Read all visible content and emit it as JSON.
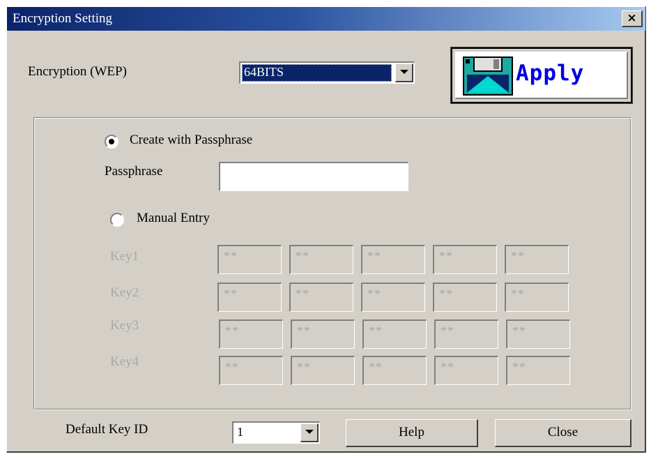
{
  "window": {
    "title": "Encryption Setting",
    "close_glyph": "×"
  },
  "encryption": {
    "label": "Encryption (WEP)",
    "selected": "64BITS"
  },
  "apply_button": {
    "label": "Apply",
    "icon": "floppy-disk-icon"
  },
  "passphrase_mode": {
    "create_label": "Create with Passphrase",
    "create_checked": true,
    "passphrase_label": "Passphrase",
    "passphrase_value": ""
  },
  "manual_entry": {
    "label": "Manual Entry",
    "checked": false,
    "keys": [
      {
        "label": "Key1",
        "bytes": [
          "**",
          "**",
          "**",
          "**",
          "**"
        ]
      },
      {
        "label": "Key2",
        "bytes": [
          "**",
          "**",
          "**",
          "**",
          "**"
        ]
      },
      {
        "label": "Key3",
        "bytes": [
          "**",
          "**",
          "**",
          "**",
          "**"
        ]
      },
      {
        "label": "Key4",
        "bytes": [
          "**",
          "**",
          "**",
          "**",
          "**"
        ]
      }
    ]
  },
  "default_key": {
    "label": "Default Key ID",
    "selected": "1"
  },
  "buttons": {
    "help": "Help",
    "close": "Close"
  },
  "colors": {
    "face": "#d4d0c8",
    "title_start": "#0a246a",
    "title_end": "#a6caf0",
    "apply_text": "#0000e0",
    "disabled_text": "#a8a8a8"
  }
}
